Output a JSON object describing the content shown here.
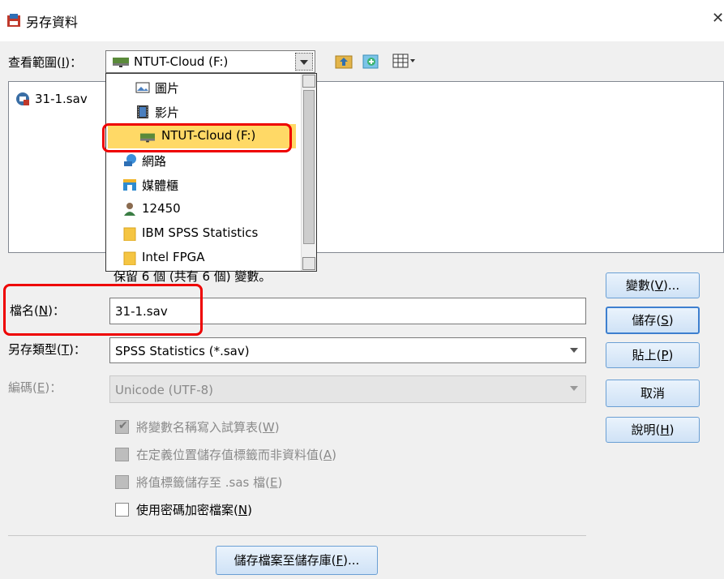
{
  "window": {
    "title": "另存資料",
    "close_glyph": "✕"
  },
  "look_in": {
    "label_pre": "查看範圍(",
    "label_key": "I",
    "label_post": ")：",
    "value": "NTUT-Cloud (F:)"
  },
  "toolbar_icons": [
    "up-folder-icon",
    "new-folder-icon",
    "view-menu-icon"
  ],
  "file_list": [
    {
      "name": "31-1.sav",
      "icon": "sav-file-icon"
    }
  ],
  "dropdown_items": [
    {
      "label": "圖片",
      "icon": "pictures-icon"
    },
    {
      "label": "影片",
      "icon": "videos-icon"
    },
    {
      "label": "NTUT-Cloud (F:)",
      "icon": "network-drive-icon",
      "selected": true
    },
    {
      "label": "網路",
      "icon": "network-icon"
    },
    {
      "label": "媒體櫃",
      "icon": "library-icon"
    },
    {
      "label": "12450",
      "icon": "user-icon"
    },
    {
      "label": "IBM SPSS Statistics",
      "icon": "folder-icon"
    },
    {
      "label": "Intel FPGA",
      "icon": "folder-icon"
    }
  ],
  "keep_vars_text": "保留 6 個 (共有 6 個) 變數。",
  "filename": {
    "label_pre": "檔名(",
    "label_key": "N",
    "label_post": ")：",
    "value": "31-1.sav"
  },
  "save_type": {
    "label_pre": "另存類型(",
    "label_key": "T",
    "label_post": ")：",
    "value": "SPSS Statistics (*.sav)"
  },
  "encoding": {
    "label_pre": "編碼(",
    "label_key": "E",
    "label_post": ")：",
    "value": "Unicode (UTF-8)"
  },
  "checkboxes": [
    {
      "pre": "將變數名稱寫入試算表(",
      "key": "W",
      "post": ")",
      "checked": true,
      "disabled": true
    },
    {
      "pre": "在定義位置儲存值標籤而非資料值(",
      "key": "A",
      "post": ")",
      "checked": false,
      "disabled": true
    },
    {
      "pre": "將值標籤儲存至 .sas 檔(",
      "key": "E",
      "post": ")",
      "checked": false,
      "disabled": true
    },
    {
      "pre": "使用密碼加密檔案(",
      "key": "N",
      "post": ")",
      "checked": false,
      "disabled": false
    }
  ],
  "buttons": {
    "variables": {
      "pre": "變數(",
      "key": "V",
      "post": ")..."
    },
    "save": {
      "pre": "儲存(",
      "key": "S",
      "post": ")"
    },
    "paste": {
      "pre": "貼上(",
      "key": "P",
      "post": ")"
    },
    "cancel": {
      "label": "取消"
    },
    "help": {
      "pre": "說明(",
      "key": "H",
      "post": ")"
    },
    "save_to_repo": {
      "pre": "儲存檔案至儲存庫(",
      "key": "F",
      "post": ")..."
    }
  },
  "colors": {
    "highlight_red": "#e00000",
    "selected_bg": "#ffd966",
    "button_border": "#6a9fd4"
  }
}
